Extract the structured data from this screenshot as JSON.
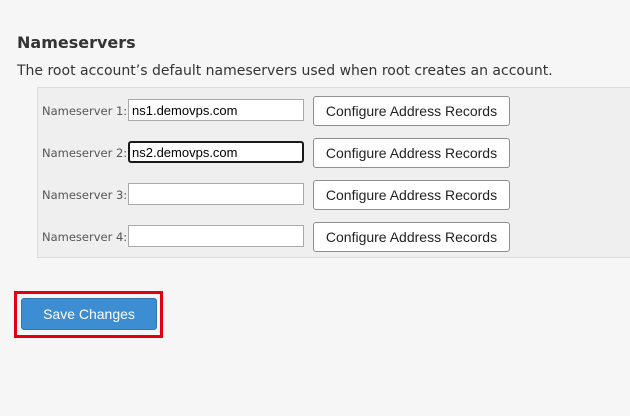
{
  "section": {
    "title": "Nameservers",
    "description": "The root account’s default nameservers used when root creates an account."
  },
  "nameservers": [
    {
      "label": "Nameserver 1:",
      "value": "ns1.demovps.com",
      "button": "Configure Address Records"
    },
    {
      "label": "Nameserver 2:",
      "value": "ns2.demovps.com",
      "button": "Configure Address Records",
      "focused": true
    },
    {
      "label": "Nameserver 3:",
      "value": "",
      "button": "Configure Address Records"
    },
    {
      "label": "Nameserver 4:",
      "value": "",
      "button": "Configure Address Records"
    }
  ],
  "actions": {
    "save_label": "Save Changes"
  },
  "colors": {
    "save_button": "#3d8dd3",
    "highlight_border": "#e3000f",
    "background": "#f6f6f6"
  }
}
